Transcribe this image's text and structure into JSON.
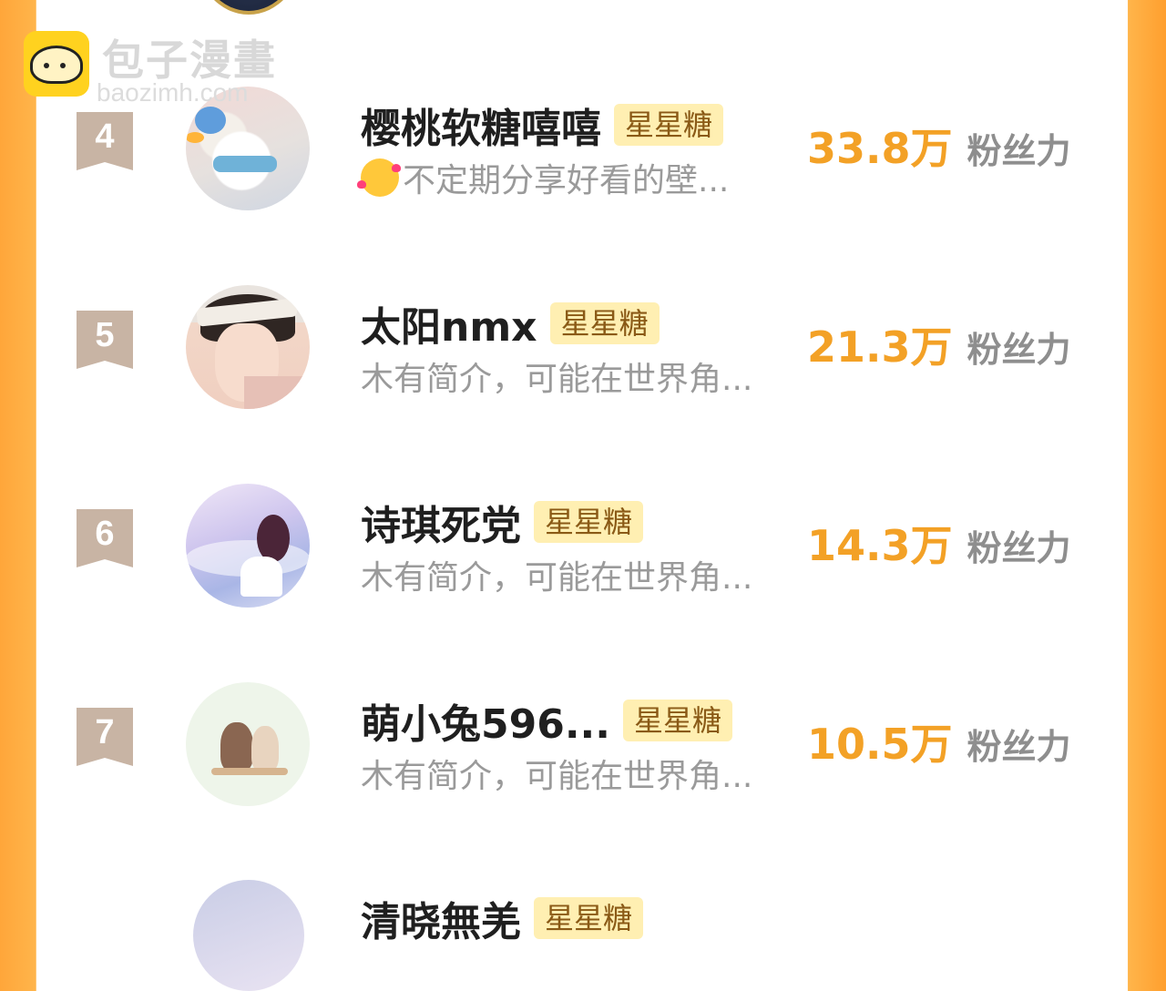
{
  "watermark": {
    "brand": "包子漫畫",
    "url": "baozimh.com"
  },
  "badge_label": "星星糖",
  "fans_label": "粉丝力",
  "rows": [
    {
      "rank": "4",
      "name": "樱桃软糖嘻嘻",
      "bio": "不定期分享好看的壁...",
      "fans": "33.8万",
      "avatar_icon": "dog-avatar",
      "bio_icon": "smiling-hearts-emoji"
    },
    {
      "rank": "5",
      "name": "太阳nmx",
      "bio": "木有简介，可能在世界角...",
      "fans": "21.3万",
      "avatar_icon": "man-avatar"
    },
    {
      "rank": "6",
      "name": "诗琪死党",
      "bio": "木有简介，可能在世界角...",
      "fans": "14.3万",
      "avatar_icon": "girl-avatar"
    },
    {
      "rank": "7",
      "name": "萌小兔596...",
      "bio": "木有简介，可能在世界角...",
      "fans": "10.5万",
      "avatar_icon": "cats-avatar"
    }
  ],
  "partial_bottom": {
    "name": "清晓無羌"
  },
  "colors": {
    "fans_value": "#f3a126",
    "badge_bg": "#ffefb2",
    "rank_bg": "#c8b4a4",
    "side_orange": "#ffa63a"
  }
}
